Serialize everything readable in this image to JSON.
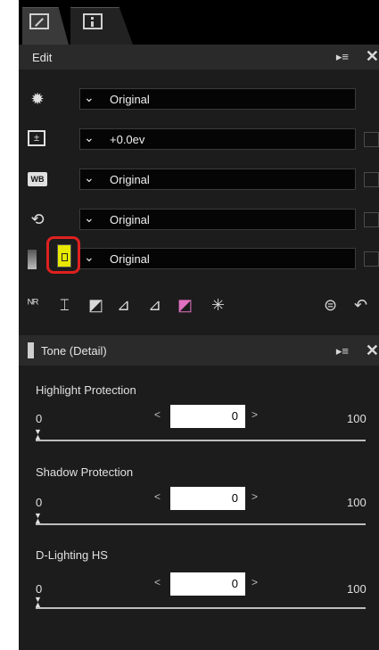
{
  "tabs": [
    {
      "name": "edit",
      "icon": "edit-icon"
    },
    {
      "name": "info",
      "icon": "info-icon"
    }
  ],
  "edit_panel": {
    "title": "Edit",
    "rows": [
      {
        "icon": "gear-icon",
        "value": "Original",
        "checkbox": false
      },
      {
        "icon": "exposure-icon",
        "value": "+0.0ev",
        "checkbox": true
      },
      {
        "icon": "wb-icon",
        "icon_text": "WB",
        "value": "Original",
        "checkbox": true
      },
      {
        "icon": "picture-control-icon",
        "value": "Original",
        "checkbox": true
      },
      {
        "icon": "tone-detail-icon",
        "value": "Original",
        "checkbox": true
      }
    ],
    "toolbar": [
      "noise-reduction-icon",
      "crop-icon",
      "levels-icon",
      "perspective-icon",
      "straighten-icon",
      "color-icon",
      "retouch-icon",
      "history-icon",
      "undo-icon"
    ]
  },
  "tone_panel": {
    "title": "Tone (Detail)",
    "sliders": [
      {
        "label": "Highlight Protection",
        "min": "0",
        "max": "100",
        "value": "0",
        "level": 0
      },
      {
        "label": "Shadow Protection",
        "min": "0",
        "max": "100",
        "value": "0",
        "level": 0
      },
      {
        "label": "D-Lighting HS",
        "min": "0",
        "max": "100",
        "value": "0",
        "level": 0
      }
    ]
  }
}
